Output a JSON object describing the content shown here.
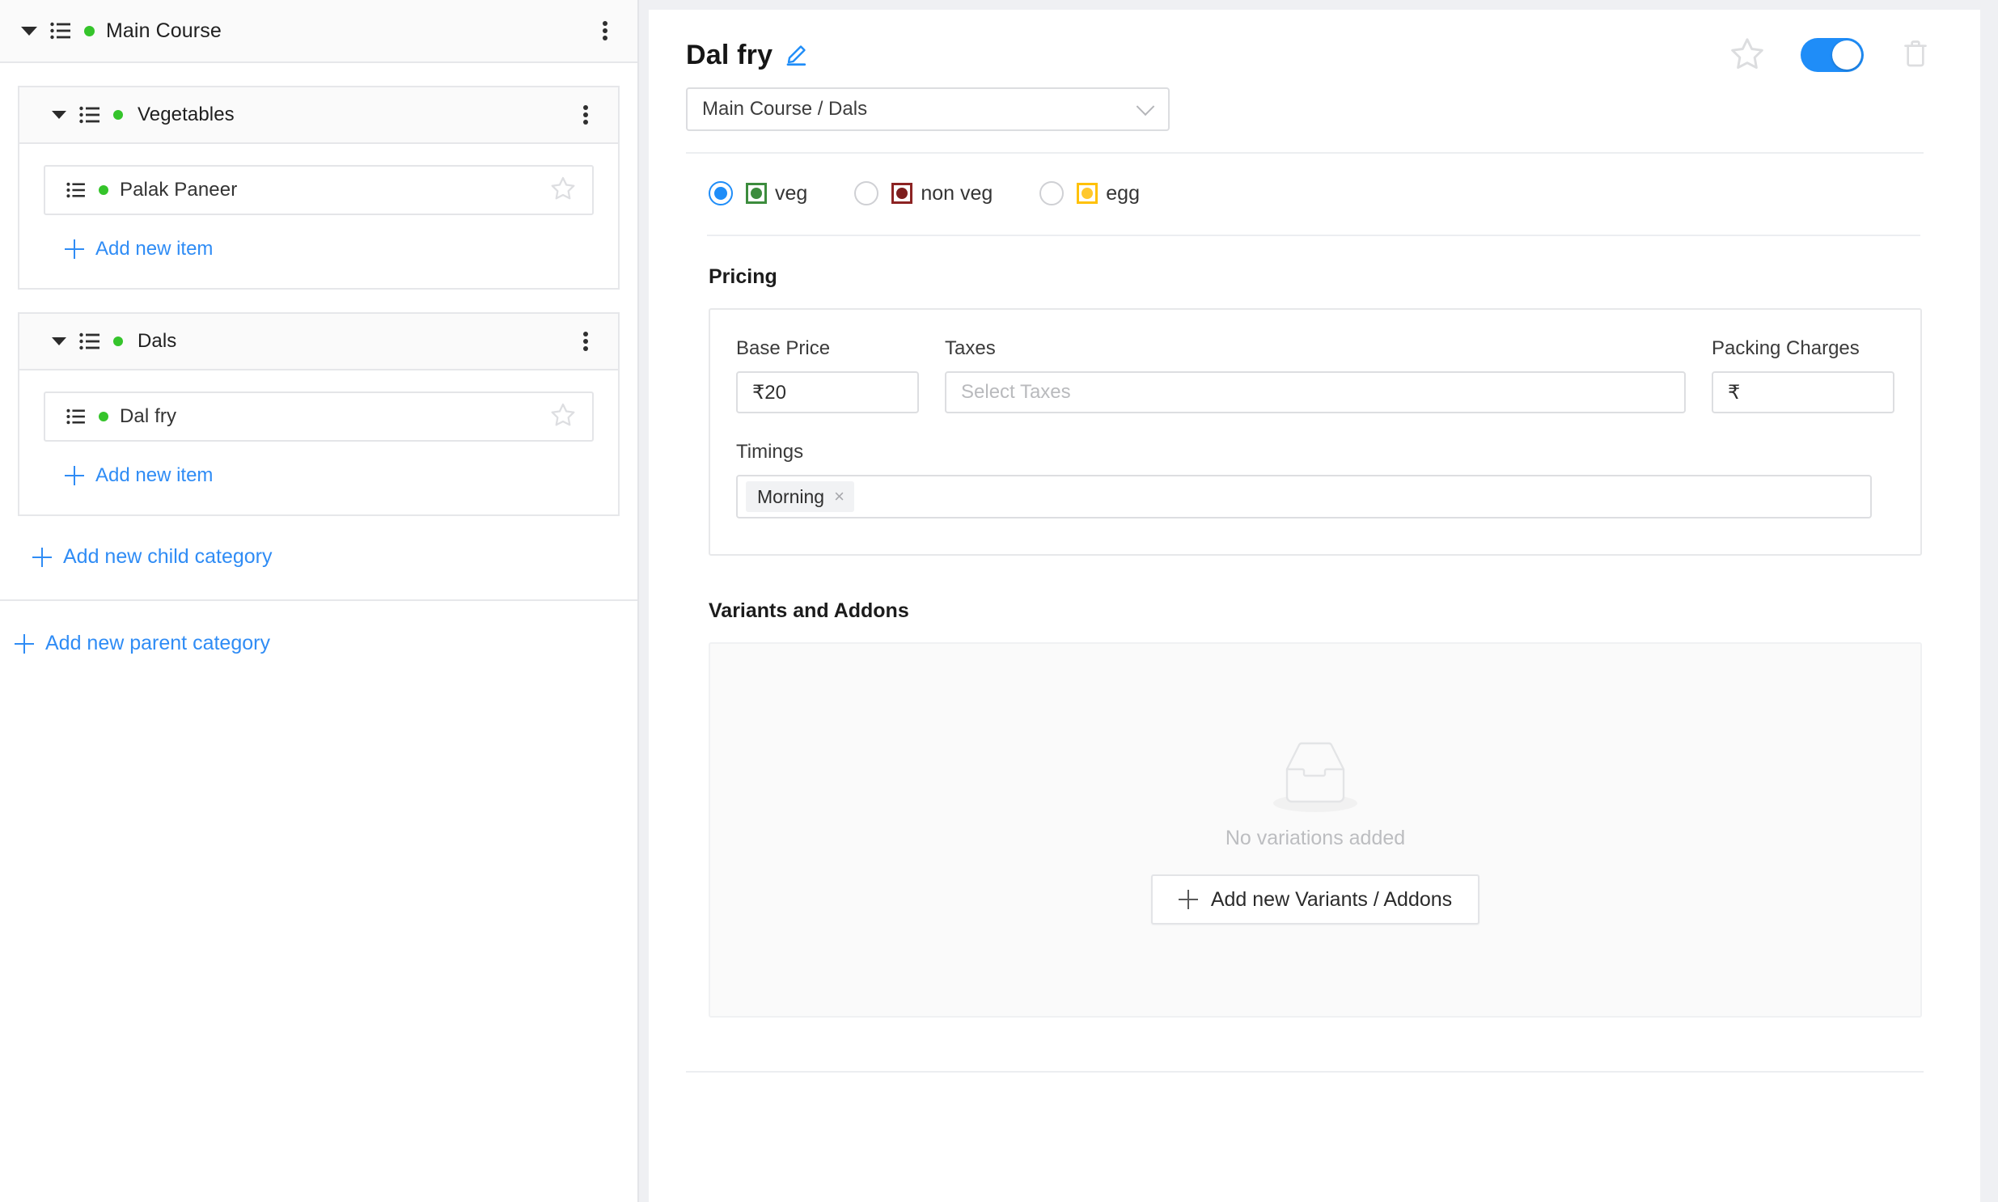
{
  "sidebar": {
    "parent_category": {
      "label": "Main Course",
      "caret_icon": "caret-down-icon",
      "list_icon": "list-icon",
      "status_dot": "green-dot",
      "menu_icon": "kebab-menu-icon"
    },
    "child_categories": [
      {
        "label": "Vegetables",
        "items": [
          {
            "label": "Palak Paneer",
            "favorite": false
          }
        ],
        "add_item_label": "Add new item"
      },
      {
        "label": "Dals",
        "items": [
          {
            "label": "Dal fry",
            "favorite": false
          }
        ],
        "add_item_label": "Add new item"
      }
    ],
    "add_child_category_label": "Add new child category",
    "add_parent_category_label": "Add new parent category"
  },
  "detail": {
    "title": "Dal fry",
    "edit_icon": "pencil-edit-icon",
    "favorite_icon": "star-outline-icon",
    "delete_icon": "trash-icon",
    "availability_toggle": {
      "state": "on",
      "color": "#1f8df8"
    },
    "category_select": {
      "value": "Main Course / Dals",
      "chevron_icon": "chevron-down-icon"
    },
    "food_types": [
      {
        "label": "veg",
        "selected": true,
        "mark_color": "#3c8c3d",
        "dot_color": "#3c8c3d"
      },
      {
        "label": "non veg",
        "selected": false,
        "mark_color": "#8c2323",
        "dot_color": "#7d1f1f"
      },
      {
        "label": "egg",
        "selected": false,
        "mark_color": "#ffc107",
        "dot_color": "#ffc82e"
      }
    ],
    "pricing": {
      "section_title": "Pricing",
      "base_price": {
        "label": "Base Price",
        "value": "₹20"
      },
      "taxes": {
        "label": "Taxes",
        "value": "",
        "placeholder": "Select Taxes"
      },
      "packing_charges": {
        "label": "Packing Charges",
        "value": "₹"
      },
      "timings": {
        "label": "Timings",
        "tags": [
          {
            "label": "Morning",
            "remove_icon": "×"
          }
        ]
      }
    },
    "variants": {
      "section_title": "Variants and Addons",
      "empty_icon": "empty-tray-icon",
      "empty_text": "No variations added",
      "add_button_label": "Add new Variants / Addons"
    }
  },
  "colors": {
    "accent_blue": "#2f8cf5",
    "toggle_blue": "#1f8df8",
    "status_green": "#35c42b",
    "page_bg": "#eff0f3"
  }
}
